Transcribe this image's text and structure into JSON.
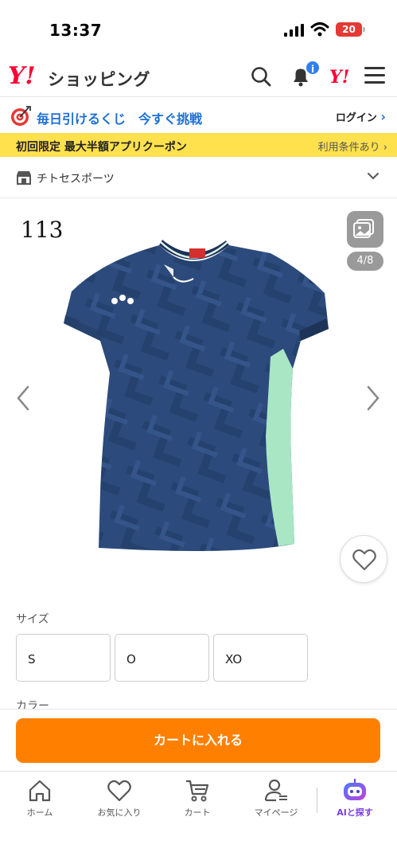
{
  "status_bar": {
    "time": "13:37",
    "battery": "20"
  },
  "header": {
    "logo_mark": "Y!",
    "logo_text": "ショッピング",
    "notification_badge": "i",
    "yahoo_mark": "Y!"
  },
  "lottery_bar": {
    "text": "毎日引けるくじ　今すぐ挑戦",
    "login_label": "ログイン"
  },
  "coupon_bar": {
    "text": "初回限定 最大半額アプリクーポン",
    "terms_label": "利用条件あり"
  },
  "store": {
    "name": "チトセスポーツ"
  },
  "product": {
    "label": "113",
    "image_counter": "4/8",
    "colors": {
      "shirt_main": "#2c4a7c",
      "shirt_accent": "#a8e6c4"
    }
  },
  "size_section": {
    "label": "サイズ",
    "options": [
      "S",
      "O",
      "XO"
    ]
  },
  "color_section": {
    "label": "カラー"
  },
  "cart": {
    "button_label": "カートに入れる",
    "color": "#ff8000"
  },
  "bottom_nav": {
    "items": [
      {
        "label": "ホーム",
        "icon": "home-icon"
      },
      {
        "label": "お気に入り",
        "icon": "heart-icon"
      },
      {
        "label": "カート",
        "icon": "cart-icon"
      },
      {
        "label": "マイページ",
        "icon": "user-icon"
      },
      {
        "label": "AIと探す",
        "icon": "ai-robot-icon"
      }
    ]
  }
}
